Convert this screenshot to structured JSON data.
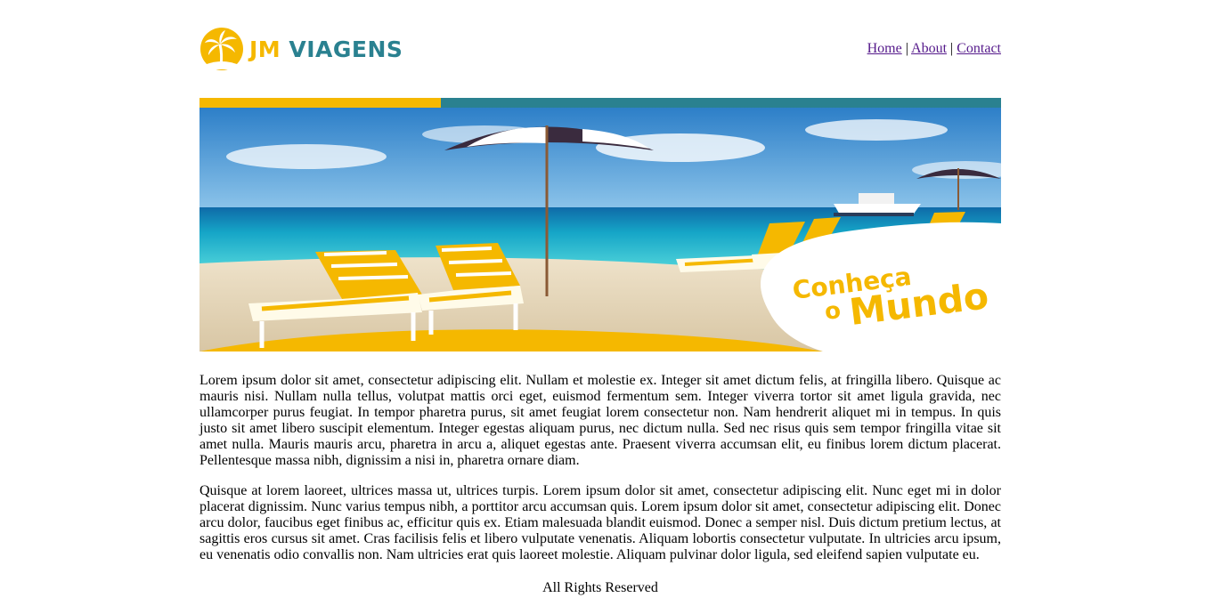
{
  "header": {
    "logo": {
      "jm": "JM",
      "viagens": "VIAGENS",
      "icon": "palm-tree-icon"
    },
    "nav": [
      {
        "label": "Home"
      },
      {
        "label": "About"
      },
      {
        "label": "Contact"
      }
    ],
    "nav_separator": "|"
  },
  "banner": {
    "tagline_line1": "Conheça",
    "tagline_o": "o",
    "tagline_mundo": "Mundo"
  },
  "content": {
    "paragraphs": [
      "Lorem ipsum dolor sit amet, consectetur adipiscing elit. Nullam et molestie ex. Integer sit amet dictum felis, at fringilla libero. Quisque ac mauris nisi. Nullam nulla tellus, volutpat mattis orci eget, euismod fermentum sem. Integer viverra tortor sit amet ligula gravida, nec ullamcorper purus feugiat. In tempor pharetra purus, sit amet feugiat lorem consectetur non. Nam hendrerit aliquet mi in tempus. In quis justo sit amet libero suscipit elementum. Integer egestas aliquam purus, nec dictum nulla. Sed nec risus quis sem tempor fringilla vitae sit amet nulla. Mauris mauris arcu, pharetra in arcu a, aliquet egestas ante. Praesent viverra accumsan elit, eu finibus lorem dictum placerat. Pellentesque massa nibh, dignissim a nisi in, pharetra ornare diam.",
      "Quisque at lorem laoreet, ultrices massa ut, ultrices turpis. Lorem ipsum dolor sit amet, consectetur adipiscing elit. Nunc eget mi in dolor placerat dignissim. Nunc varius tempus nibh, a porttitor arcu accumsan quis. Lorem ipsum dolor sit amet, consectetur adipiscing elit. Donec arcu dolor, faucibus eget finibus ac, efficitur quis ex. Etiam malesuada blandit euismod. Donec a semper nisl. Duis dictum pretium lectus, at sagittis eros cursus sit amet. Cras facilisis felis et libero vulputate venenatis. Aliquam lobortis consectetur vulputate. In ultricies arcu ipsum, eu venenatis odio convallis non. Nam ultricies erat quis laoreet molestie. Aliquam pulvinar dolor ligula, sed eleifend sapien vulputate eu."
    ]
  },
  "footer": {
    "text": "All Rights Reserved"
  },
  "colors": {
    "brand_yellow": "#f5b800",
    "brand_teal": "#2a8190",
    "link_visited": "#551a8b"
  }
}
